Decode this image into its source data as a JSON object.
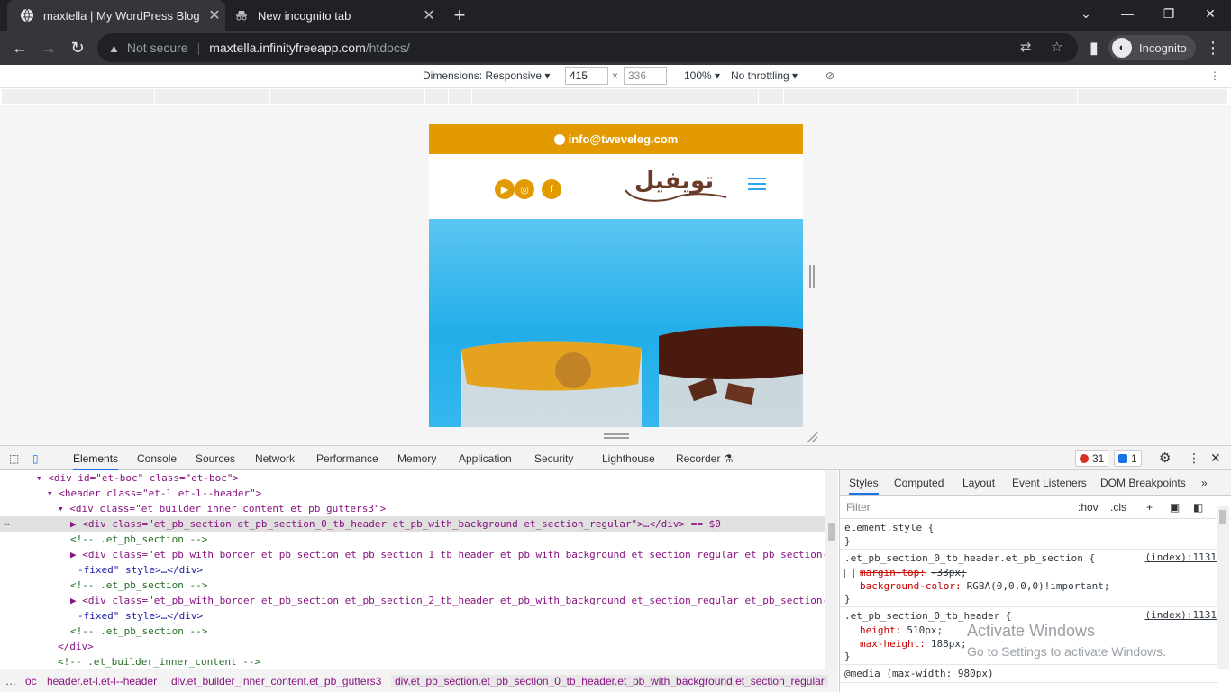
{
  "tabs": [
    {
      "title": "maxtella | My WordPress Blog",
      "icon": "globe-icon"
    },
    {
      "title": "New incognito tab",
      "icon": "incognito-icon"
    }
  ],
  "address": {
    "security": "Not secure",
    "host": "maxtella.infinityfreeapp.com",
    "path": "/htdocs/"
  },
  "profile": {
    "label": "Incognito"
  },
  "device_toolbar": {
    "dimensions_label": "Dimensions: Responsive",
    "width": "415",
    "height_placeholder": "336",
    "times": "×",
    "zoom": "100%",
    "throttle": "No throttling"
  },
  "site": {
    "email": "info@tweveleg.com",
    "logo_text": "تويفيل",
    "social": [
      "▶",
      "◎",
      "f"
    ]
  },
  "devtools": {
    "tabs": [
      "Elements",
      "Console",
      "Sources",
      "Network",
      "Performance",
      "Memory",
      "Application",
      "Security",
      "Lighthouse",
      "Recorder"
    ],
    "errors": "31",
    "messages": "1",
    "dom_lines": [
      {
        "indent": 0,
        "text": "<div id=\"et-boc\" class=\"et-boc\">"
      },
      {
        "indent": 1,
        "text": "<header class=\"et-l et-l--header\">"
      },
      {
        "indent": 2,
        "text": "<div class=\"et_builder_inner_content et_pb_gutters3\">"
      },
      {
        "indent": 3,
        "text": "<div class=\"et_pb_section et_pb_section_0_tb_header et_pb_with_background et_section_regular\">…</div> == $0"
      },
      {
        "indent": 3,
        "text": "<!-- .et_pb_section -->"
      },
      {
        "indent": 3,
        "text": "<div class=\"et_pb_with_border et_pb_section et_pb_section_1_tb_header et_pb_with_background et_section_regular et_pb_section-"
      },
      {
        "indent": 3,
        "text": "-fixed\" style>…</div>"
      },
      {
        "indent": 3,
        "text": "<!-- .et_pb_section -->"
      },
      {
        "indent": 3,
        "text": "<div class=\"et_pb_with_border et_pb_section et_pb_section_2_tb_header et_pb_with_background et_section_regular et_pb_section-"
      },
      {
        "indent": 3,
        "text": "-fixed\" style>…</div>"
      },
      {
        "indent": 3,
        "text": "<!-- .et_pb_section -->"
      },
      {
        "indent": 2,
        "text": "</div>"
      },
      {
        "indent": 2,
        "text": "<!-- .et_builder_inner_content -->"
      }
    ],
    "styles_tabs": [
      "Styles",
      "Computed",
      "Layout",
      "Event Listeners",
      "DOM Breakpoints"
    ],
    "filter_placeholder": "Filter",
    "filter_opts": [
      ":hov",
      ".cls",
      "+"
    ],
    "rules": [
      {
        "selector": "element.style {",
        "close": "}",
        "src": "",
        "props": []
      },
      {
        "selector": ".et_pb_section_0_tb_header.et_pb_section {",
        "close": "}",
        "src": "(index):1131",
        "props": [
          {
            "name": "margin-top:",
            "value": "-33px;",
            "struck": true
          },
          {
            "name": "background-color:",
            "value": "RGBA(0,0,0,0)!important;",
            "struck": false
          }
        ]
      },
      {
        "selector": ".et_pb_section_0_tb_header {",
        "close": "}",
        "src": "(index):1131",
        "props": [
          {
            "name": "height:",
            "value": "510px;",
            "struck": false
          },
          {
            "name": "max-height:",
            "value": "188px;",
            "struck": false
          }
        ]
      },
      {
        "selector": "@media (max-width: 980px)",
        "close": "",
        "src": "",
        "props": []
      }
    ],
    "watermark_title": "Activate Windows",
    "watermark_sub": "Go to Settings to activate Windows.",
    "breadcrumbs": [
      "…",
      "oc",
      "header.et-l.et-l--header",
      "div.et_builder_inner_content.et_pb_gutters3",
      "div.et_pb_section.et_pb_section_0_tb_header.et_pb_with_background.et_section_regular"
    ]
  }
}
